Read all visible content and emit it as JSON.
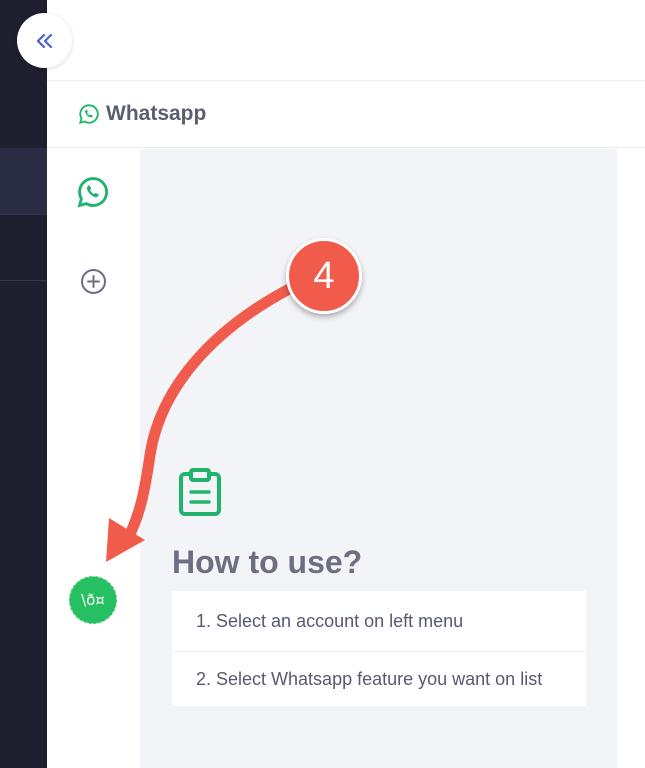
{
  "header": {
    "title": "Whatsapp"
  },
  "sidebar": {
    "collapse_icon": "double-chevron-left-icon",
    "items": [
      {
        "name": "whatsapp-icon"
      },
      {
        "name": "plus-circle-icon"
      }
    ],
    "avatar_text": "\\ð¤"
  },
  "main": {
    "clipboard_icon": "clipboard-icon",
    "how_to_title": "How to use?",
    "steps": [
      "1. Select an account on left menu",
      "2. Select Whatsapp feature you want on list"
    ]
  },
  "annotation": {
    "step_number": "4"
  },
  "colors": {
    "accent_green": "#20b36b",
    "whatsapp_green": "#26c062",
    "dark_sidebar": "#1e1f2f",
    "annotation_red": "#f05b4b",
    "collapse_blue": "#4a5fd1"
  }
}
